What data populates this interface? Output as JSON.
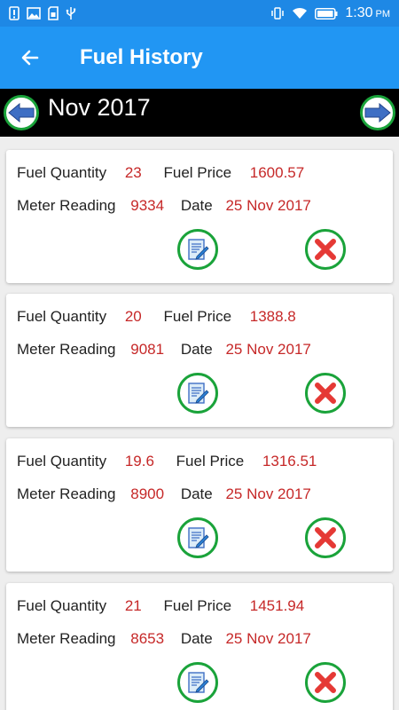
{
  "status": {
    "time": "1:30",
    "ampm": "PM"
  },
  "header": {
    "title": "Fuel History"
  },
  "month": {
    "label": "Nov 2017"
  },
  "labels": {
    "fuel_quantity": "Fuel Quantity",
    "fuel_price": "Fuel Price",
    "meter_reading": "Meter Reading",
    "date": "Date"
  },
  "records": [
    {
      "quantity": "23",
      "price": "1600.57",
      "meter": "9334",
      "date": "25 Nov 2017"
    },
    {
      "quantity": "20",
      "price": "1388.8",
      "meter": "9081",
      "date": "25 Nov 2017"
    },
    {
      "quantity": "19.6",
      "price": "1316.51",
      "meter": "8900",
      "date": "25 Nov 2017"
    },
    {
      "quantity": "21",
      "price": "1451.94",
      "meter": "8653",
      "date": "25 Nov 2017"
    }
  ],
  "colors": {
    "app_bar": "#2196f3",
    "status_bar": "#1e88e5",
    "value_text": "#c62828",
    "ring_green": "#1aa33a",
    "delete_red": "#e53935",
    "arrow_blue": "#3f6fc4"
  },
  "icons": {
    "back": "arrow-left-icon",
    "prev": "blue-left-arrow-icon",
    "next": "blue-right-arrow-icon",
    "edit": "edit-document-icon",
    "delete": "red-x-icon"
  }
}
